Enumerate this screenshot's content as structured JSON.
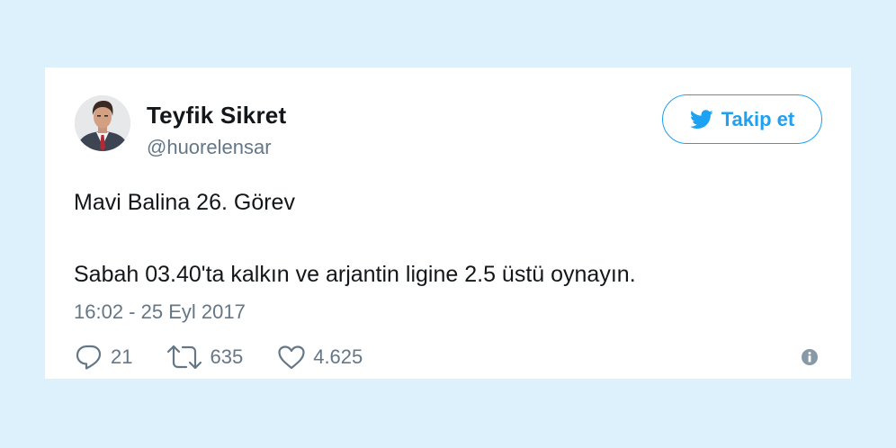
{
  "user": {
    "name": "Teyfik Sikret",
    "handle": "@huorelensar",
    "avatar_icon": "profile-photo"
  },
  "follow_button": {
    "label": "Takip et",
    "icon": "twitter-bird-icon",
    "color": "#1da1f2"
  },
  "tweet": {
    "line1": "Mavi Balina 26. Görev",
    "line2": "Sabah 03.40'ta kalkın ve arjantin ligine 2.5 üstü oynayın.",
    "timestamp": "16:02 - 25 Eyl 2017"
  },
  "actions": {
    "replies": "21",
    "retweets": "635",
    "likes": "4.625",
    "reply_icon": "reply-icon",
    "retweet_icon": "retweet-icon",
    "like_icon": "heart-icon",
    "info_icon": "info-icon"
  },
  "colors": {
    "background": "#dcf1fc",
    "card": "#ffffff",
    "text": "#14171a",
    "secondary": "#657786",
    "accent": "#1da1f2"
  }
}
